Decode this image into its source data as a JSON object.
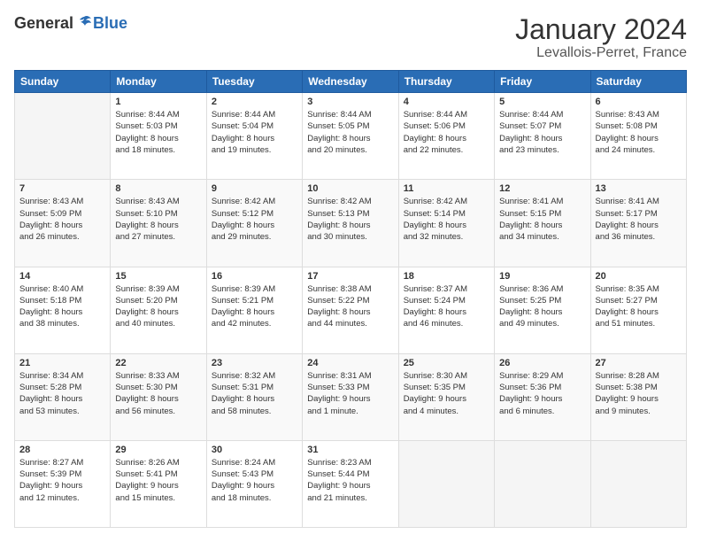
{
  "logo": {
    "general": "General",
    "blue": "Blue"
  },
  "header": {
    "title": "January 2024",
    "subtitle": "Levallois-Perret, France"
  },
  "days_of_week": [
    "Sunday",
    "Monday",
    "Tuesday",
    "Wednesday",
    "Thursday",
    "Friday",
    "Saturday"
  ],
  "weeks": [
    [
      {
        "day": "",
        "info": ""
      },
      {
        "day": "1",
        "info": "Sunrise: 8:44 AM\nSunset: 5:03 PM\nDaylight: 8 hours\nand 18 minutes."
      },
      {
        "day": "2",
        "info": "Sunrise: 8:44 AM\nSunset: 5:04 PM\nDaylight: 8 hours\nand 19 minutes."
      },
      {
        "day": "3",
        "info": "Sunrise: 8:44 AM\nSunset: 5:05 PM\nDaylight: 8 hours\nand 20 minutes."
      },
      {
        "day": "4",
        "info": "Sunrise: 8:44 AM\nSunset: 5:06 PM\nDaylight: 8 hours\nand 22 minutes."
      },
      {
        "day": "5",
        "info": "Sunrise: 8:44 AM\nSunset: 5:07 PM\nDaylight: 8 hours\nand 23 minutes."
      },
      {
        "day": "6",
        "info": "Sunrise: 8:43 AM\nSunset: 5:08 PM\nDaylight: 8 hours\nand 24 minutes."
      }
    ],
    [
      {
        "day": "7",
        "info": "Sunrise: 8:43 AM\nSunset: 5:09 PM\nDaylight: 8 hours\nand 26 minutes."
      },
      {
        "day": "8",
        "info": "Sunrise: 8:43 AM\nSunset: 5:10 PM\nDaylight: 8 hours\nand 27 minutes."
      },
      {
        "day": "9",
        "info": "Sunrise: 8:42 AM\nSunset: 5:12 PM\nDaylight: 8 hours\nand 29 minutes."
      },
      {
        "day": "10",
        "info": "Sunrise: 8:42 AM\nSunset: 5:13 PM\nDaylight: 8 hours\nand 30 minutes."
      },
      {
        "day": "11",
        "info": "Sunrise: 8:42 AM\nSunset: 5:14 PM\nDaylight: 8 hours\nand 32 minutes."
      },
      {
        "day": "12",
        "info": "Sunrise: 8:41 AM\nSunset: 5:15 PM\nDaylight: 8 hours\nand 34 minutes."
      },
      {
        "day": "13",
        "info": "Sunrise: 8:41 AM\nSunset: 5:17 PM\nDaylight: 8 hours\nand 36 minutes."
      }
    ],
    [
      {
        "day": "14",
        "info": "Sunrise: 8:40 AM\nSunset: 5:18 PM\nDaylight: 8 hours\nand 38 minutes."
      },
      {
        "day": "15",
        "info": "Sunrise: 8:39 AM\nSunset: 5:20 PM\nDaylight: 8 hours\nand 40 minutes."
      },
      {
        "day": "16",
        "info": "Sunrise: 8:39 AM\nSunset: 5:21 PM\nDaylight: 8 hours\nand 42 minutes."
      },
      {
        "day": "17",
        "info": "Sunrise: 8:38 AM\nSunset: 5:22 PM\nDaylight: 8 hours\nand 44 minutes."
      },
      {
        "day": "18",
        "info": "Sunrise: 8:37 AM\nSunset: 5:24 PM\nDaylight: 8 hours\nand 46 minutes."
      },
      {
        "day": "19",
        "info": "Sunrise: 8:36 AM\nSunset: 5:25 PM\nDaylight: 8 hours\nand 49 minutes."
      },
      {
        "day": "20",
        "info": "Sunrise: 8:35 AM\nSunset: 5:27 PM\nDaylight: 8 hours\nand 51 minutes."
      }
    ],
    [
      {
        "day": "21",
        "info": "Sunrise: 8:34 AM\nSunset: 5:28 PM\nDaylight: 8 hours\nand 53 minutes."
      },
      {
        "day": "22",
        "info": "Sunrise: 8:33 AM\nSunset: 5:30 PM\nDaylight: 8 hours\nand 56 minutes."
      },
      {
        "day": "23",
        "info": "Sunrise: 8:32 AM\nSunset: 5:31 PM\nDaylight: 8 hours\nand 58 minutes."
      },
      {
        "day": "24",
        "info": "Sunrise: 8:31 AM\nSunset: 5:33 PM\nDaylight: 9 hours\nand 1 minute."
      },
      {
        "day": "25",
        "info": "Sunrise: 8:30 AM\nSunset: 5:35 PM\nDaylight: 9 hours\nand 4 minutes."
      },
      {
        "day": "26",
        "info": "Sunrise: 8:29 AM\nSunset: 5:36 PM\nDaylight: 9 hours\nand 6 minutes."
      },
      {
        "day": "27",
        "info": "Sunrise: 8:28 AM\nSunset: 5:38 PM\nDaylight: 9 hours\nand 9 minutes."
      }
    ],
    [
      {
        "day": "28",
        "info": "Sunrise: 8:27 AM\nSunset: 5:39 PM\nDaylight: 9 hours\nand 12 minutes."
      },
      {
        "day": "29",
        "info": "Sunrise: 8:26 AM\nSunset: 5:41 PM\nDaylight: 9 hours\nand 15 minutes."
      },
      {
        "day": "30",
        "info": "Sunrise: 8:24 AM\nSunset: 5:43 PM\nDaylight: 9 hours\nand 18 minutes."
      },
      {
        "day": "31",
        "info": "Sunrise: 8:23 AM\nSunset: 5:44 PM\nDaylight: 9 hours\nand 21 minutes."
      },
      {
        "day": "",
        "info": ""
      },
      {
        "day": "",
        "info": ""
      },
      {
        "day": "",
        "info": ""
      }
    ]
  ]
}
